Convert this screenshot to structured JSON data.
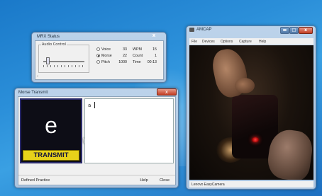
{
  "mrx_status": {
    "title": "MRX Status",
    "close_label": "x",
    "group_label": "Audio Control",
    "scroll_arrow": "‹",
    "modes": [
      {
        "label": "Voice",
        "value": "33",
        "stat_label": "WPM",
        "stat_value": "15",
        "selected": false
      },
      {
        "label": "Morse",
        "value": "22",
        "stat_label": "Count",
        "stat_value": "1",
        "selected": true
      },
      {
        "label": "Pitch",
        "value": "1000",
        "stat_label": "Time",
        "stat_value": "00:13",
        "selected": false
      }
    ]
  },
  "morse_transmit": {
    "title": "Morse Transmit",
    "close_label": "x",
    "current_letter": "e",
    "transmit_label": "TRANSMIT",
    "typed_text": "a",
    "status": "Defined Practice",
    "help_label": "Help",
    "close_button_label": "Close"
  },
  "amcap": {
    "title": "AMCAP",
    "window_buttons": {
      "minimize": "▬",
      "maximize": "□",
      "close": "x"
    },
    "menu": [
      "File",
      "Devices",
      "Options",
      "Capture",
      "Help"
    ],
    "status": "Lenovo EasyCamera"
  },
  "colors": {
    "transmit_button": "#e7d21a",
    "transmit_text": "#14143c",
    "close_button": "#c33c22",
    "letter_panel": "#0d0d16"
  }
}
